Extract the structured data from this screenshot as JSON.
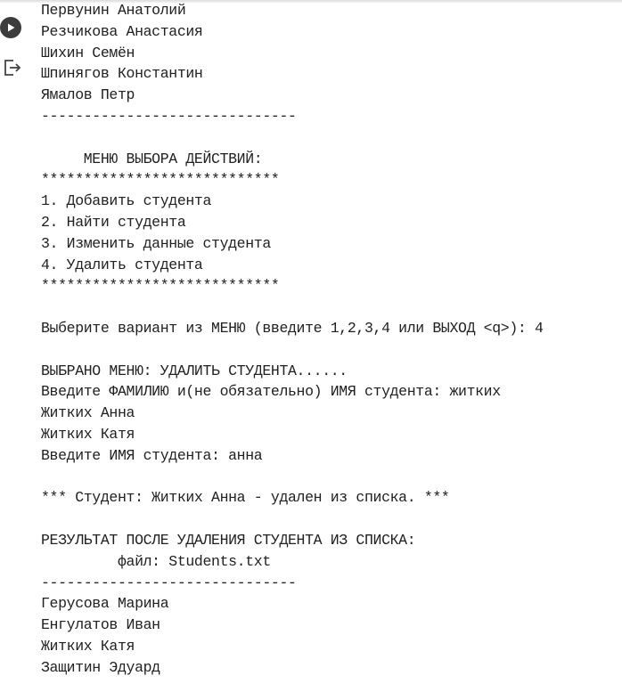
{
  "console": {
    "lines": [
      "Первунин Анатолий",
      "Резчикова Анастасия",
      "Шихин Семён",
      "Шпинягов Константин",
      "Ямалов Петр",
      "------------------------------",
      "",
      "     МЕНЮ ВЫБОРА ДЕЙСТВИЙ:",
      "****************************",
      "1. Добавить студента",
      "2. Найти студента",
      "3. Изменить данные студента",
      "4. Удалить студента",
      "****************************",
      "",
      "Выберите вариант из МЕНЮ (введите 1,2,3,4 или ВЫХОД <q>): 4",
      "",
      "ВЫБРАНО МЕНЮ: УДАЛИТЬ СТУДЕНТА......",
      "Введите ФАМИЛИЮ и(не обязательно) ИМЯ студента: житких",
      "Житких Анна",
      "Житких Катя",
      "Введите ИМЯ студента: анна",
      "",
      "*** Студент: Житких Анна - удален из списка. ***",
      "",
      "РЕЗУЛЬТАТ ПОСЛЕ УДАЛЕНИЯ СТУДЕНТА ИЗ СПИСКА:",
      "         файл: Students.txt",
      "------------------------------",
      "Герусова Марина",
      "Енгулатов Иван",
      "Житких Катя",
      "Защитин Эдуард"
    ]
  },
  "icons": {
    "run": "play-circle-icon",
    "output": "output-exit-icon"
  }
}
